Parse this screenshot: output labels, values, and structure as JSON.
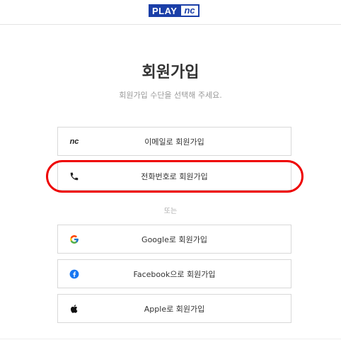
{
  "header": {
    "logo_play": "PLAY",
    "logo_nc": "nc"
  },
  "page": {
    "title": "회원가입",
    "subtitle": "회원가입 수단을 선택해 주세요."
  },
  "signup": {
    "email_icon_text": "nc",
    "email_label": "이메일로 회원가입",
    "phone_label": "전화번호로 회원가입",
    "or_text": "또는",
    "google_label": "Google로 회원가입",
    "facebook_label": "Facebook으로 회원가입",
    "apple_label": "Apple로 회원가입"
  },
  "colors": {
    "brand": "#1b3fa8",
    "highlight": "#ee0000",
    "facebook": "#1877f2"
  }
}
